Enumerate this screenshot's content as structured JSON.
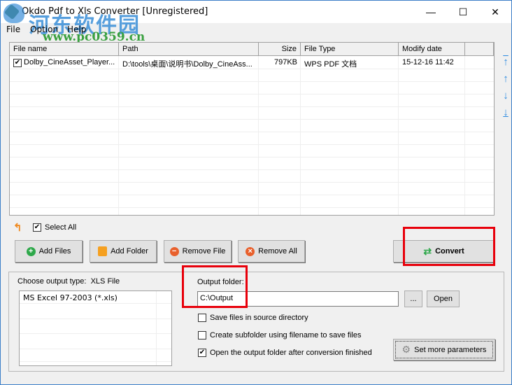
{
  "window": {
    "title": "Okdo Pdf to Xls Converter [Unregistered]",
    "minimize": "—",
    "maximize": "☐",
    "close": "✕"
  },
  "watermark": {
    "name": "河东软件园",
    "url": "www.pc0359.cn"
  },
  "menu": [
    "File",
    "Option",
    "Help"
  ],
  "table": {
    "columns": [
      "File name",
      "Path",
      "Size",
      "File Type",
      "Modify date"
    ],
    "rows": [
      {
        "checked": true,
        "name": "Dolby_CineAsset_Player...",
        "path": "D:\\tools\\桌面\\说明书\\Dolby_CineAss...",
        "size": "797KB",
        "type": "WPS PDF 文档",
        "date": "15-12-16 11:42"
      }
    ]
  },
  "side_arrows": [
    "move-top",
    "move-up",
    "move-down",
    "move-bottom"
  ],
  "select_all": {
    "label": "Select All",
    "checked": true
  },
  "buttons": {
    "add_files": "Add Files",
    "add_folder": "Add Folder",
    "remove_file": "Remove File",
    "remove_all": "Remove All",
    "convert": "Convert"
  },
  "output": {
    "type_label": "Choose output type:",
    "type_value": "XLS File",
    "types": [
      "MS Excel 97-2003 (*.xls)"
    ],
    "folder_label": "Output folder:",
    "folder_value": "C:\\Output",
    "browse": "...",
    "open": "Open",
    "options": [
      {
        "label": "Save files in source directory",
        "checked": false
      },
      {
        "label": "Create subfolder using filename to save files",
        "checked": false
      },
      {
        "label": "Open the output folder after conversion finished",
        "checked": true
      }
    ],
    "params_button": "Set more parameters"
  }
}
